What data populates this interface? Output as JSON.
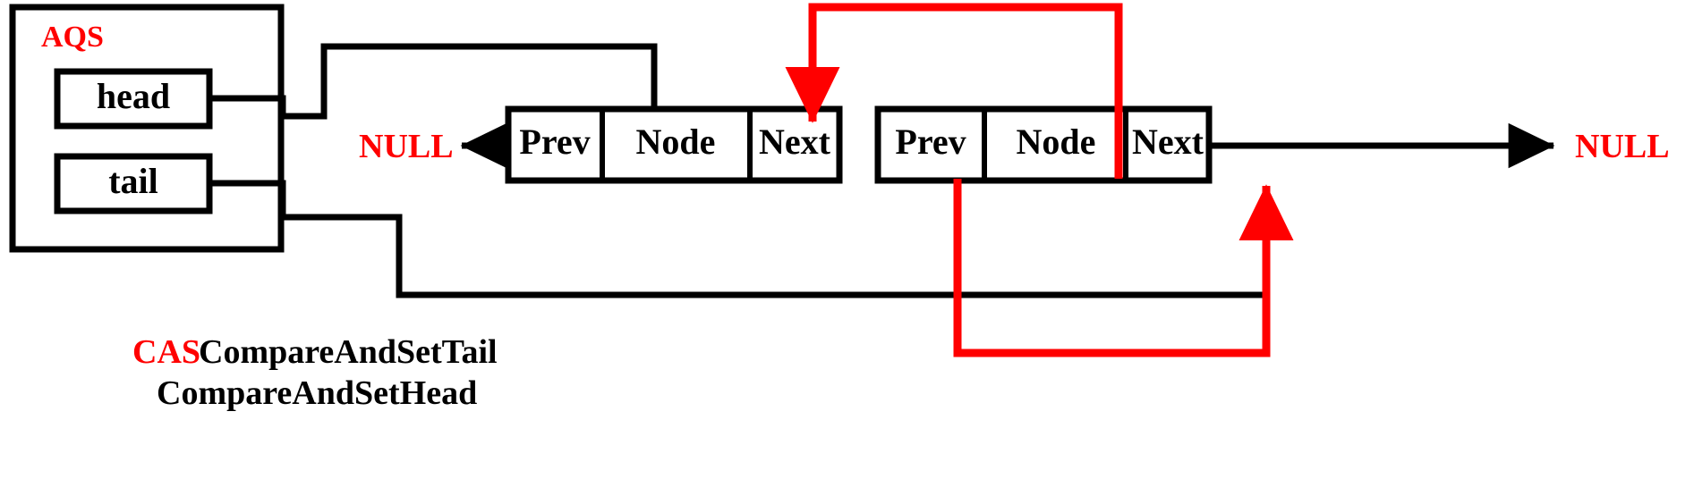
{
  "diagram": {
    "title": "AQS",
    "aqs": {
      "label": "AQS",
      "label_color": "#ff0000",
      "fields": [
        {
          "name": "head",
          "label": "head"
        },
        {
          "name": "tail",
          "label": "tail"
        }
      ]
    },
    "terminators": {
      "left_null": "NULL",
      "right_null": "NULL",
      "color": "#ff0000"
    },
    "nodes": [
      {
        "id": "node-1",
        "cells": [
          {
            "key": "prev",
            "label": "Prev"
          },
          {
            "key": "node",
            "label": "Node"
          },
          {
            "key": "next",
            "label": "Next"
          }
        ]
      },
      {
        "id": "node-2",
        "cells": [
          {
            "key": "prev",
            "label": "Prev"
          },
          {
            "key": "node",
            "label": "Node"
          },
          {
            "key": "next",
            "label": "Next"
          }
        ]
      }
    ],
    "legend": {
      "key": "CAS",
      "key_color": "#ff0000",
      "lines": [
        "CompareAndSetTail",
        "CompareAndSetHead"
      ]
    },
    "colors": {
      "line": "#000000",
      "cas": "#ff0000",
      "background": "#ffffff"
    }
  }
}
